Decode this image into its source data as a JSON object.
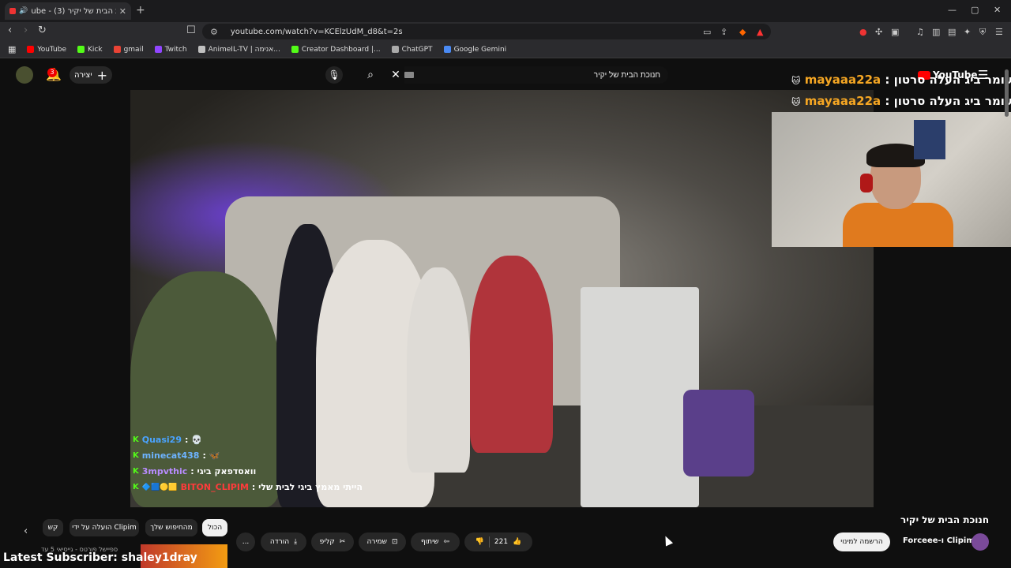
{
  "browser": {
    "tab_title": "(3) חנוכת הבית של יקיר - YouTube",
    "tab_title_short": "ube - חנוכת הבית של יקיר (3)",
    "url": "youtube.com/watch?v=KCElzUdM_d8&t=2s",
    "bookmarks": [
      {
        "label": "YouTube",
        "color": "#ff0000"
      },
      {
        "label": "Kick",
        "color": "#53fc18"
      },
      {
        "label": "gmail",
        "color": "#ea4335"
      },
      {
        "label": "Twitch",
        "color": "#9146ff"
      },
      {
        "label": "AnimeIL-TV | אנימה...",
        "color": "#c0c0c0"
      },
      {
        "label": "Creator Dashboard |...",
        "color": "#53fc18"
      },
      {
        "label": "ChatGPT",
        "color": "#aaaaaa"
      },
      {
        "label": "Google Gemini",
        "color": "#4a8af4"
      }
    ]
  },
  "header": {
    "create_label": "יצירה",
    "notifications_count": "3",
    "search_value": "חנוכת הבית של יקיר",
    "logo_text": "YouTube"
  },
  "overlay": {
    "alert_1": {
      "user": "mayaaa22a",
      "text": "עומר ביג העלה סרטון : "
    },
    "alert_2": {
      "user": "mayaaa22a",
      "text": "עומר ביג העלה סרטון : "
    },
    "chat": [
      {
        "user": "Quasi29",
        "user_color": "#4aa3ff",
        "message": ": 💀"
      },
      {
        "user": "minecat438",
        "user_color": "#6db3ff",
        "message": ": 🦋"
      },
      {
        "user": "3mpvthic",
        "user_color": "#b88cff",
        "message": ": וואסדפאק ביגי"
      },
      {
        "user": "BITON_CLIPIM",
        "user_color": "#ff3b3b",
        "message": ": הייתי מאמץ ביגי לבית שלי"
      }
    ],
    "latest_subscriber": "Latest Subscriber: shaley1dray"
  },
  "video_info": {
    "title": "חנוכת הבית של יקיר",
    "channel": "Forceee-ו Clipim",
    "subscribe_label": "הרשמה למינוי",
    "likes": "221",
    "share_label": "שיתוף",
    "save_label": "שמירה",
    "clip_label": "קליפ",
    "download_label": "הורדה",
    "more_label": "..."
  },
  "chips": [
    {
      "label": "הכול",
      "active": true
    },
    {
      "label": "מהחיפוש שלך",
      "active": false
    },
    {
      "label": "הועלה על ידי Clipim",
      "active": false
    },
    {
      "label": "קש",
      "active": false
    }
  ],
  "recommendation": {
    "text": "ספיישל פורטס - גייסיאי 5 עד"
  }
}
